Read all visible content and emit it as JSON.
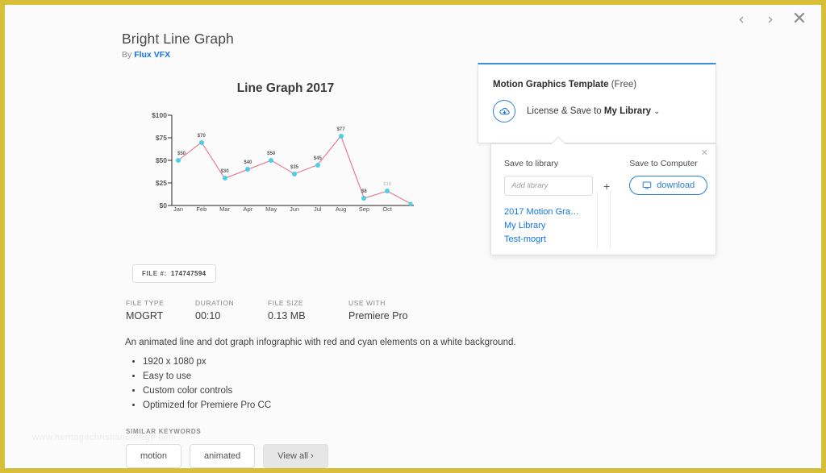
{
  "topnav": {
    "prev": "‹",
    "next": "›",
    "close": "✕"
  },
  "header": {
    "title": "Bright Line Graph",
    "by_prefix": "By",
    "author": "Flux VFX"
  },
  "chart_data": {
    "type": "line",
    "title": "Line Graph 2017",
    "xlabel": "",
    "ylabel": "",
    "categories": [
      "Jan",
      "Feb",
      "Mar",
      "Apr",
      "May",
      "Jun",
      "Jul",
      "Aug",
      "Sep",
      "Oct",
      ""
    ],
    "values": [
      50,
      70,
      30,
      40,
      50,
      35,
      45,
      77,
      8,
      16,
      2
    ],
    "point_labels": [
      "$50",
      "$70",
      "$30",
      "$40",
      "$50",
      "$35",
      "$45",
      "$77",
      "$8",
      "$16",
      ""
    ],
    "faded_labels": [
      false,
      false,
      false,
      false,
      false,
      false,
      false,
      false,
      false,
      true,
      false
    ],
    "ylim": [
      0,
      100
    ],
    "yticks": [
      "$0",
      "$25",
      "$50",
      "$75",
      "$100"
    ],
    "ytick_values": [
      0,
      25,
      50,
      75,
      100
    ],
    "grid": false,
    "legend": "none",
    "line_color": "#e8738f",
    "dot_color": "#4ccfe4"
  },
  "file_badge": {
    "label": "FILE #:",
    "value": "174747594"
  },
  "meta": [
    {
      "label": "FILE TYPE",
      "value": "MOGRT"
    },
    {
      "label": "DURATION",
      "value": "00:10"
    },
    {
      "label": "FILE SIZE",
      "value": "0.13 MB"
    },
    {
      "label": "USE WITH",
      "value": "Premiere Pro"
    }
  ],
  "description": {
    "text": "An animated line and dot graph infographic with red and cyan elements on a white background.",
    "bullets": [
      "1920 x 1080 px",
      "Easy to use",
      "Custom color controls",
      "Optimized for Premiere Pro CC"
    ]
  },
  "keywords": {
    "heading": "SIMILAR KEYWORDS",
    "chips": [
      "motion",
      "animated"
    ],
    "view_all": "View all ›"
  },
  "watermark": "www.heritagechristiancollege.com",
  "license_card": {
    "title": "Motion Graphics Template",
    "free": "(Free)",
    "license_text": "License & Save to",
    "library": "My Library",
    "chevron": "⌄"
  },
  "popup": {
    "close": "✕",
    "save_to_library_heading": "Save to library",
    "save_to_computer_heading": "Save to Computer",
    "add_library_placeholder": "Add library",
    "add_library_value": "",
    "plus": "+",
    "download_label": "download",
    "libraries": [
      "2017 Motion Gra…",
      "My Library",
      "Test-mogrt"
    ]
  },
  "colors": {
    "page_border": "#d8bf3a",
    "accent_blue": "#2a7fd4",
    "link_blue": "#1473e6",
    "card_top_border": "#3b8fdd"
  }
}
